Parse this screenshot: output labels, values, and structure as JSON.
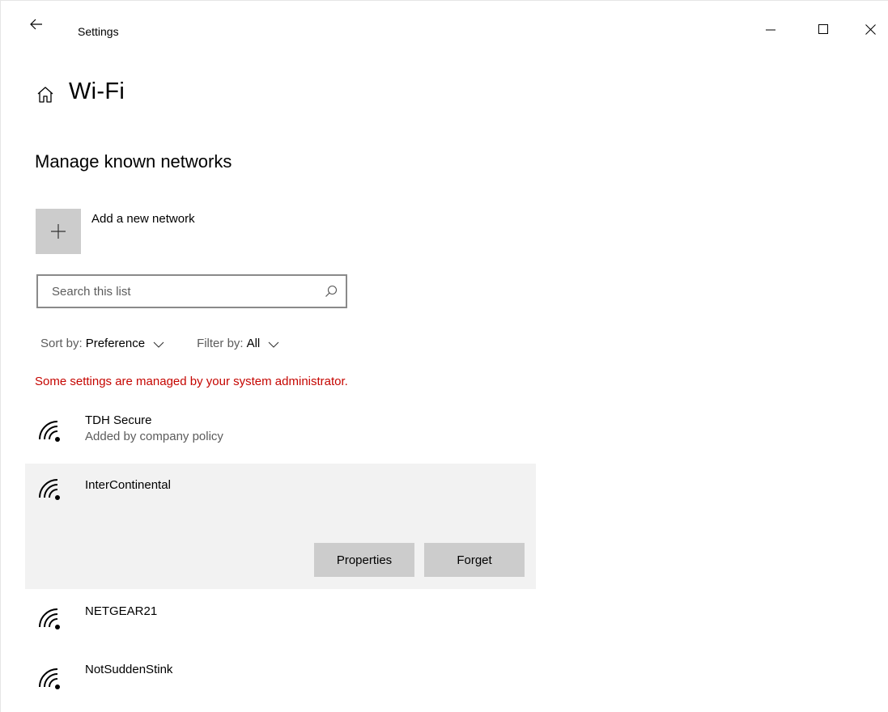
{
  "titlebar": {
    "app_title": "Settings"
  },
  "header": {
    "title": "Wi-Fi"
  },
  "section": {
    "title": "Manage known networks"
  },
  "add_network": {
    "label": "Add a new network"
  },
  "search": {
    "placeholder": "Search this list",
    "value": ""
  },
  "sort": {
    "label": "Sort by:",
    "value": "Preference"
  },
  "filter": {
    "label": "Filter by:",
    "value": "All"
  },
  "admin_note": "Some settings are managed by your system administrator.",
  "networks": [
    {
      "name": "TDH Secure",
      "subtitle": "Added by company policy",
      "selected": false
    },
    {
      "name": "InterContinental",
      "subtitle": "",
      "selected": true
    },
    {
      "name": "NETGEAR21",
      "subtitle": "",
      "selected": false
    },
    {
      "name": "NotSuddenStink",
      "subtitle": "",
      "selected": false
    }
  ],
  "actions": {
    "properties_label": "Properties",
    "forget_label": "Forget"
  },
  "icons": {
    "back": "back-arrow-icon",
    "home": "home-icon",
    "add": "plus-icon",
    "search": "search-icon",
    "wifi": "wifi-signal-icon",
    "minimize": "minimize-icon",
    "maximize": "maximize-icon",
    "close": "close-icon"
  },
  "colors": {
    "admin_note": "#c50500",
    "tile": "#cccccc",
    "selected_row": "#f2f2f2",
    "search_border": "#8a8a8a"
  }
}
